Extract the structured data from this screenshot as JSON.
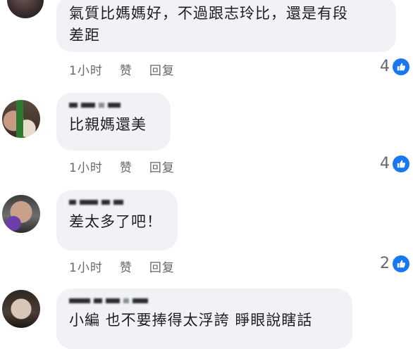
{
  "comments": [
    {
      "text": "氣質比媽媽好，不過跟志玲比，還是有段\n差距",
      "time": "1小时",
      "like_label": "赞",
      "reply_label": "回复",
      "reactions": "4"
    },
    {
      "text": "比親媽還美",
      "time": "1小时",
      "like_label": "赞",
      "reply_label": "回复",
      "reactions": "4"
    },
    {
      "text": "差太多了吧！",
      "time": "1小时",
      "like_label": "赞",
      "reply_label": "回复",
      "reactions": "2"
    },
    {
      "text": "小編 也不要捧得太浮誇 睜眼說瞎話"
    }
  ],
  "colors": {
    "bubble": "#f0f2f5",
    "meta_text": "#65676b",
    "like_blue": "#1877f2"
  },
  "icons": [
    "like-icon"
  ]
}
